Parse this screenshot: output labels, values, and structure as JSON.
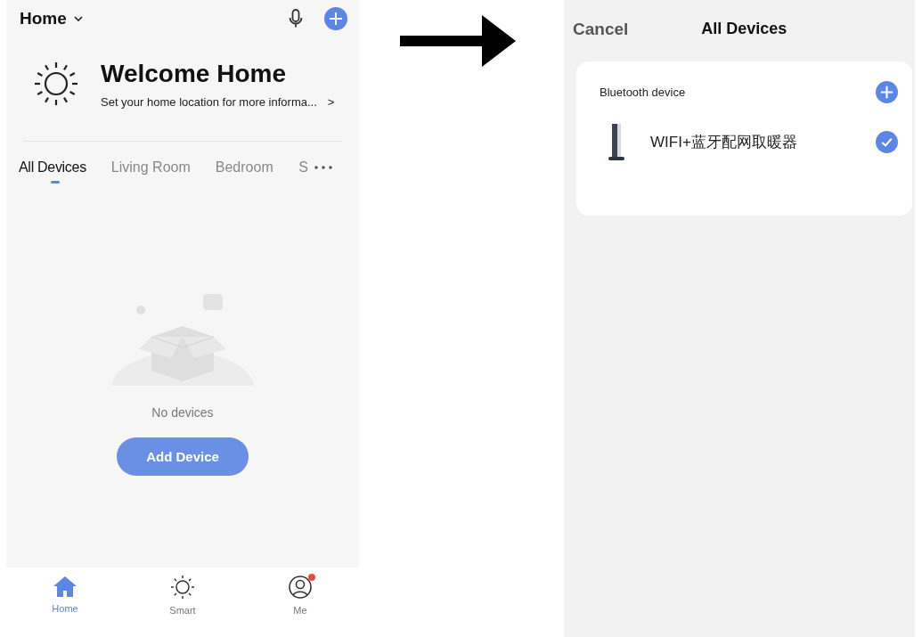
{
  "home_screen": {
    "header": {
      "title": "Home"
    },
    "welcome": {
      "title": "Welcome Home",
      "subtitle": "Set your home location for more informa...",
      "chevron": ">"
    },
    "tabs": [
      {
        "label": "All Devices",
        "selected": true
      },
      {
        "label": "Living Room",
        "selected": false
      },
      {
        "label": "Bedroom",
        "selected": false
      },
      {
        "label": "S",
        "selected": false
      }
    ],
    "empty_state": {
      "message": "No devices",
      "button": "Add Device"
    },
    "bottom_nav": [
      {
        "label": "Home",
        "kind": "home",
        "selected": true,
        "badge": false
      },
      {
        "label": "Smart",
        "kind": "smart",
        "selected": false,
        "badge": false
      },
      {
        "label": "Me",
        "kind": "me",
        "selected": false,
        "badge": true
      }
    ]
  },
  "devices_screen": {
    "cancel": "Cancel",
    "title": "All Devices",
    "section": {
      "title": "Bluetooth device"
    },
    "devices": [
      {
        "name": "WIFI+蓝牙配网取暖器",
        "selected": true
      }
    ]
  }
}
